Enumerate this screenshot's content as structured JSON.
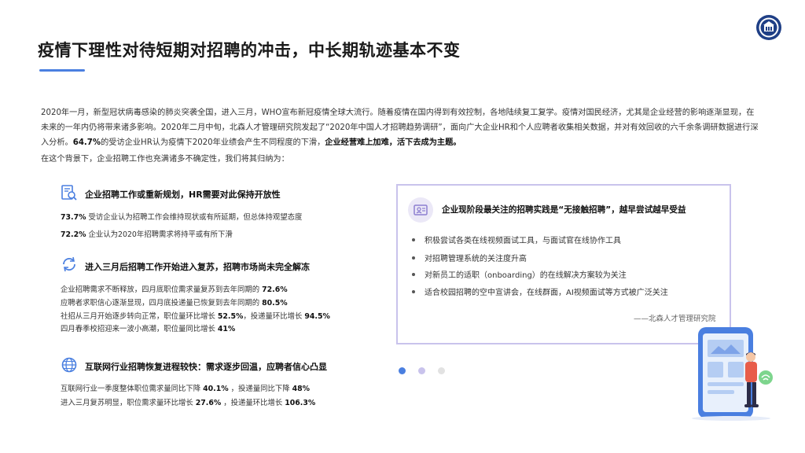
{
  "header": {
    "title": "疫情下理性对待短期对招聘的冲击，中长期轨迹基本不变"
  },
  "intro": {
    "part1": "2020年一月，新型冠状病毒感染的肺炎突袭全国，进入三月，WHO宣布新冠疫情全球大流行。随着疫情在国内得到有效控制，各地陆续复工复学。疫情对国民经济，尤其是企业经营的影响逐渐显现，在未来的一年内仍将带来诸多影响。2020年二月中旬，北森人才管理研究院发起了“2020年中国人才招聘趋势调研”，面向广大企业HR和个人应聘者收集相关数据，并对有效回收的六千余条调研数据进行深入分析。",
    "bold1": "64.7%",
    "part2": "的受访企业HR认为疫情下2020年业绩会产生不同程度的下滑，",
    "bold2": "企业经营难上加难，活下去成为主题。",
    "line2": "在这个背景下，企业招聘工作也充满诸多不确定性，我们将其归纳为："
  },
  "sections": [
    {
      "icon": "document-search-icon",
      "heading": "企业招聘工作或重新规划，HR需要对此保持开放性",
      "lines": [
        {
          "bold": "73.7%",
          "text": " 受访企业认为招聘工作会维持现状或有所延期，但总体持观望态度"
        },
        {
          "bold": "72.2%",
          "text": " 企业认为2020年招聘需求将持平或有所下滑"
        }
      ]
    },
    {
      "icon": "refresh-icon",
      "heading": "进入三月后招聘工作开始进入复苏，招聘市场尚未完全解冻",
      "lines": [
        {
          "text": "企业招聘需求不断释放，四月底职位需求量复苏到去年同期的 ",
          "bold": "72.6%"
        },
        {
          "text": "应聘者求职信心逐渐显现，四月底投递量已恢复到去年同期的 ",
          "bold": "80.5%"
        },
        {
          "text": "社招从三月开始逐步转向正常，职位量环比增长 ",
          "bold": "52.5%",
          "text2": "，投递量环比增长 ",
          "bold2": "94.5%"
        },
        {
          "text": "四月春季校招迎来一波小高潮，职位量同比增长 ",
          "bold": "41%"
        }
      ]
    },
    {
      "icon": "globe-icon",
      "heading": "互联网行业招聘恢复进程较快：需求逐步回温，应聘者信心凸显",
      "lines": [
        {
          "text": "互联网行业一季度整体职位需求量同比下降 ",
          "bold": "40.1%",
          "text2": " ，投递量同比下降 ",
          "bold2": "48%"
        },
        {
          "text": "进入三月复苏明显，职位需求量环比增长 ",
          "bold": "27.6%",
          "text2": " ，投递量环比增长 ",
          "bold2": "106.3%"
        }
      ]
    }
  ],
  "card": {
    "icon": "video-interview-icon",
    "heading": "企业现阶段最关注的招聘实践是“无接触招聘”，越早尝试越早受益",
    "bullets": [
      "积极尝试各类在线视频面试工具，与面试官在线协作工具",
      "对招聘管理系统的关注度升高",
      "对新员工的适职（onboarding）的在线解决方案较为关注",
      "适合校园招聘的空中宣讲会，在线群面，AI视频面试等方式被广泛关注"
    ],
    "source": "——北森人才管理研究院"
  },
  "pager": {
    "count": 3,
    "active": 0
  },
  "colors": {
    "accent": "#4a7fe0",
    "card_border": "#c9c3ec",
    "icon_blue": "#4a7fe0",
    "icon_purple": "#8d7fd1"
  }
}
